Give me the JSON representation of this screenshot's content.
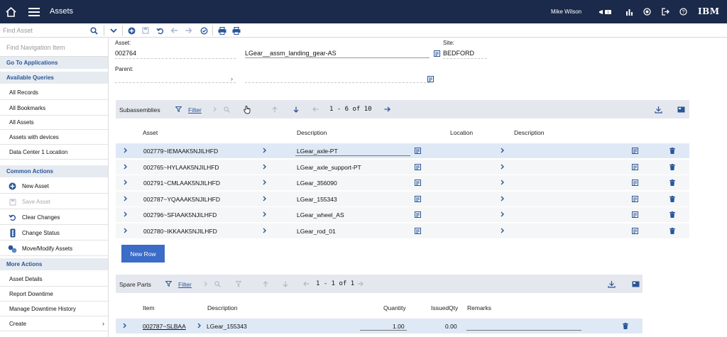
{
  "header": {
    "app_title": "Assets",
    "user_name": "Mike Wilson",
    "brand": "IBM",
    "icons": [
      "home-icon",
      "menu-icon",
      "notifications-icon",
      "reports-icon",
      "help-circle-icon",
      "logout-icon",
      "question-icon"
    ]
  },
  "toolbar": {
    "find_asset_placeholder": "Find Asset",
    "icons": [
      "search-icon",
      "chevron-down-icon",
      "add-icon",
      "save-icon",
      "undo-icon",
      "previous-icon",
      "next-icon",
      "clear-icon",
      "print-icon",
      "print-icon"
    ]
  },
  "sidebar": {
    "find_nav_placeholder": "Find Navigation Item",
    "go_to_apps": "Go To Applications",
    "available_queries": "Available Queries",
    "queries": [
      "All Records",
      "All Bookmarks",
      "All Assets",
      "Assets with devices",
      "Data Center 1 Location"
    ],
    "common_actions": "Common Actions",
    "actions": [
      {
        "label": "New Asset",
        "icon": "add-circle-icon",
        "disabled": false
      },
      {
        "label": "Save Asset",
        "icon": "save-icon",
        "disabled": true
      },
      {
        "label": "Clear Changes",
        "icon": "undo-icon",
        "disabled": false
      },
      {
        "label": "Change Status",
        "icon": "status-icon",
        "disabled": false
      },
      {
        "label": "Move/Modify Assets",
        "icon": "move-icon",
        "disabled": false
      }
    ],
    "more_actions": "More Actions",
    "more": [
      "Asset Details",
      "Report Downtime",
      "Manage Downtime History",
      "Create"
    ]
  },
  "form": {
    "asset_label": "Asset:",
    "asset_value": "002764",
    "asset_desc": "LGear__assm_landing_gear-AS",
    "site_label": "Site:",
    "site_value": "BEDFORD",
    "parent_label": "Parent:"
  },
  "subassemblies": {
    "title": "Subassemblies",
    "filter_label": "Filter",
    "pager": "1 - 6 of 10",
    "columns": [
      "Asset",
      "Description",
      "Location",
      "Description"
    ],
    "rows": [
      {
        "asset": "002779~IEMAAK5NJILHFD",
        "description": "LGear_axle-PT"
      },
      {
        "asset": "002765~HYLAAK5NJILHFD",
        "description": "LGear_axle_support-PT"
      },
      {
        "asset": "002791~CMLAAK5NJILHFD",
        "description": "LGear_356090"
      },
      {
        "asset": "002787~YQAAAK5NJILHFD",
        "description": "LGear_155343"
      },
      {
        "asset": "002796~SFIAAK5NJILHFD",
        "description": "LGear_wheel_AS"
      },
      {
        "asset": "002780~IKKAAK5NJILHFD",
        "description": "LGear_rod_01"
      }
    ],
    "new_row_label": "New Row"
  },
  "spare_parts": {
    "title": "Spare Parts",
    "filter_label": "Filter",
    "pager": "1 - 1 of 1",
    "columns": [
      "Item",
      "Description",
      "Quantity",
      "IssuedQty",
      "Remarks"
    ],
    "rows": [
      {
        "item": "002787~SLBAA",
        "description": "LGear_155343",
        "quantity": "1.00",
        "issued": "0.00"
      }
    ]
  },
  "colors": {
    "topbar": "#1b2a4a",
    "accent": "#2a5597",
    "button": "#3a6cc8",
    "selected_row": "#dfe9f6"
  }
}
